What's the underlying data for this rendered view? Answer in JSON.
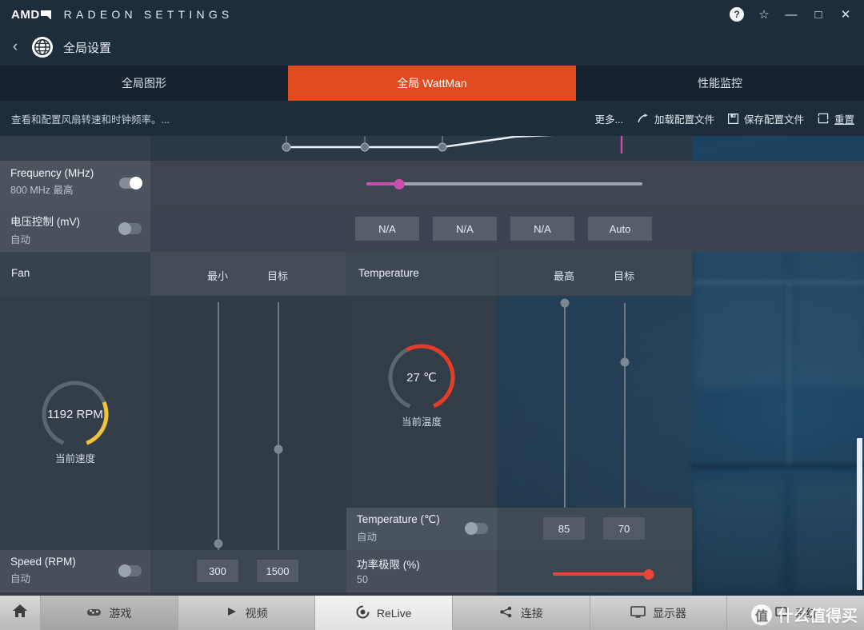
{
  "titlebar": {
    "brand": "AMD",
    "product": "RADEON SETTINGS",
    "help_label": "?",
    "star_label": "☆",
    "minimize_label": "—",
    "maximize_label": "□",
    "close_label": "✕"
  },
  "breadcrumb": {
    "back_label": "‹",
    "title": "全局设置"
  },
  "tabs": [
    {
      "label": "全局图形",
      "active": false
    },
    {
      "label": "全局 WattMan",
      "active": true
    },
    {
      "label": "性能监控",
      "active": false
    }
  ],
  "subbar": {
    "description": "查看和配置风扇转速和时钟频率。...",
    "more": "更多...",
    "load_profile": "加载配置文件",
    "save_profile": "保存配置文件",
    "reset": "重置"
  },
  "frequency_row": {
    "label": "Frequency (MHz)",
    "sub": "800 MHz 最高",
    "toggle_state": "on",
    "slider_value_pct": 12
  },
  "voltage_row": {
    "label": "电压控制 (mV)",
    "sub": "自动",
    "toggle_state": "off",
    "buttons": [
      "N/A",
      "N/A",
      "N/A",
      "Auto"
    ]
  },
  "headers": {
    "fan": "Fan",
    "fan_min": "最小",
    "fan_target": "目标",
    "temperature": "Temperature",
    "temp_max": "最高",
    "temp_target": "目标"
  },
  "fan_gauge": {
    "value": "1192 RPM",
    "caption": "当前速度",
    "arc_color": "#efc33c",
    "arc_pct": 28
  },
  "temp_gauge": {
    "value": "27 ℃",
    "caption": "当前温度",
    "arc_color": "#e63b27",
    "arc_pct": 58
  },
  "temperature_row": {
    "label": "Temperature (℃)",
    "sub": "自动",
    "toggle_state": "off",
    "max_value": "85",
    "target_value": "70"
  },
  "power_row": {
    "label": "功率极限 (%)",
    "sub": "50",
    "slider_value_pct": 92,
    "slider_color": "#e8453c"
  },
  "speed_row": {
    "label": "Speed (RPM)",
    "sub": "自动",
    "toggle_state": "off",
    "min_value": "300",
    "target_value": "1500"
  },
  "bottom_nav": {
    "home_icon": "home-icon",
    "items": [
      {
        "label": "游戏",
        "icon": "gamepad-icon",
        "state": "dim"
      },
      {
        "label": "视频",
        "icon": "play-icon",
        "state": "normal"
      },
      {
        "label": "ReLive",
        "icon": "relive-icon",
        "state": "active"
      },
      {
        "label": "连接",
        "icon": "share-icon",
        "state": "normal"
      },
      {
        "label": "显示器",
        "icon": "monitor-icon",
        "state": "normal"
      },
      {
        "label": "系统",
        "icon": "system-icon",
        "state": "normal"
      }
    ]
  },
  "watermark": {
    "badge": "值",
    "text": "什么值得买"
  },
  "colors": {
    "accent_orange": "#e24a20",
    "panel_dark": "#3b4651",
    "magenta": "#c94eb0"
  }
}
